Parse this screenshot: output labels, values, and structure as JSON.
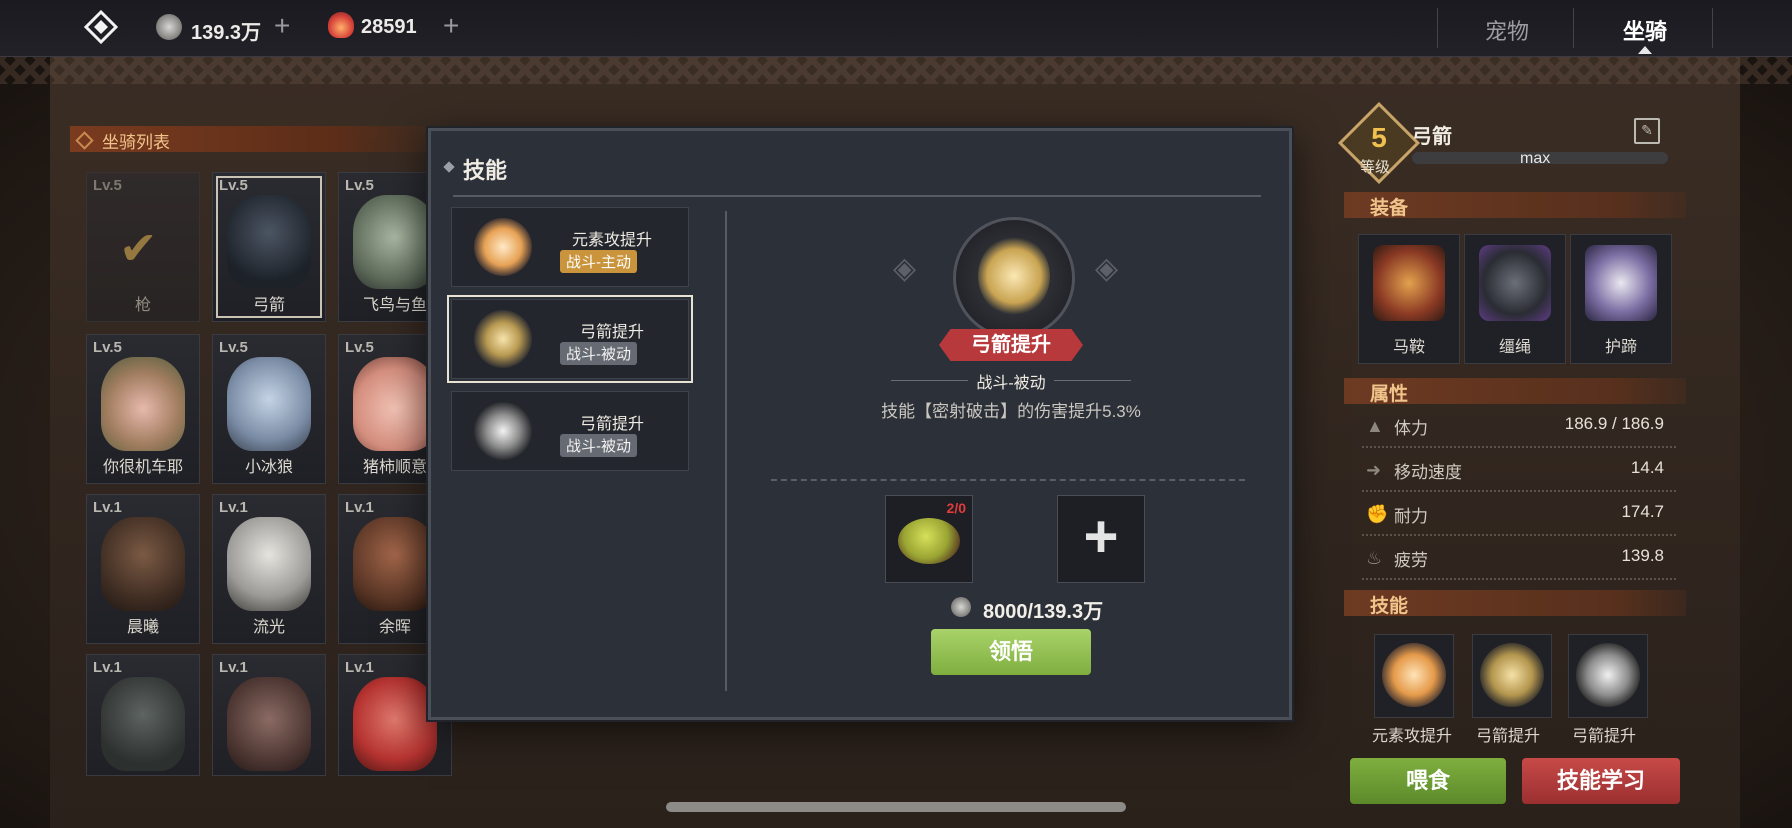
{
  "topbar": {
    "silver": "139.3万",
    "gems": "28591",
    "tabs": [
      {
        "label": "宠物",
        "active": false
      },
      {
        "label": "坐骑",
        "active": true
      }
    ]
  },
  "mount_list": {
    "title": "坐骑列表",
    "items": [
      {
        "level": "Lv.5",
        "name": "枪"
      },
      {
        "level": "Lv.5",
        "name": "弓箭"
      },
      {
        "level": "Lv.5",
        "name": "飞鸟与鱼"
      },
      {
        "level": "Lv.5",
        "name": "你很机车耶"
      },
      {
        "level": "Lv.5",
        "name": "小冰狼"
      },
      {
        "level": "Lv.5",
        "name": "猪柿顺意"
      },
      {
        "level": "Lv.1",
        "name": "晨曦"
      },
      {
        "level": "Lv.1",
        "name": "流光"
      },
      {
        "level": "Lv.1",
        "name": "余晖"
      },
      {
        "level": "Lv.1",
        "name": ""
      },
      {
        "level": "Lv.1",
        "name": ""
      },
      {
        "level": "Lv.1",
        "name": ""
      }
    ]
  },
  "skill_modal": {
    "title": "技能",
    "skills": [
      {
        "name": "元素攻提升",
        "type": "战斗-主动"
      },
      {
        "name": "弓箭提升",
        "type": "战斗-被动"
      },
      {
        "name": "弓箭提升",
        "type": "战斗-被动"
      }
    ],
    "selected": {
      "name": "弓箭提升",
      "type": "战斗-被动",
      "description": "技能【密射破击】的伤害提升5.3%",
      "item_count": "2/0",
      "cost": "8000/139.3万"
    },
    "learn_button": "领悟"
  },
  "mount_detail": {
    "level": "5",
    "level_label": "等级",
    "name": "弓箭",
    "exp_text": "max",
    "equipment_title": "装备",
    "equipment": [
      "马鞍",
      "缰绳",
      "护蹄"
    ],
    "attributes_title": "属性",
    "attributes": [
      {
        "label": "体力",
        "value": "186.9 / 186.9"
      },
      {
        "label": "移动速度",
        "value": "14.4"
      },
      {
        "label": "耐力",
        "value": "174.7"
      },
      {
        "label": "疲劳",
        "value": "139.8"
      }
    ],
    "skills_title": "技能",
    "skills": [
      "元素攻提升",
      "弓箭提升",
      "弓箭提升"
    ],
    "feed_button": "喂食",
    "learn_skill_button": "技能学习"
  }
}
